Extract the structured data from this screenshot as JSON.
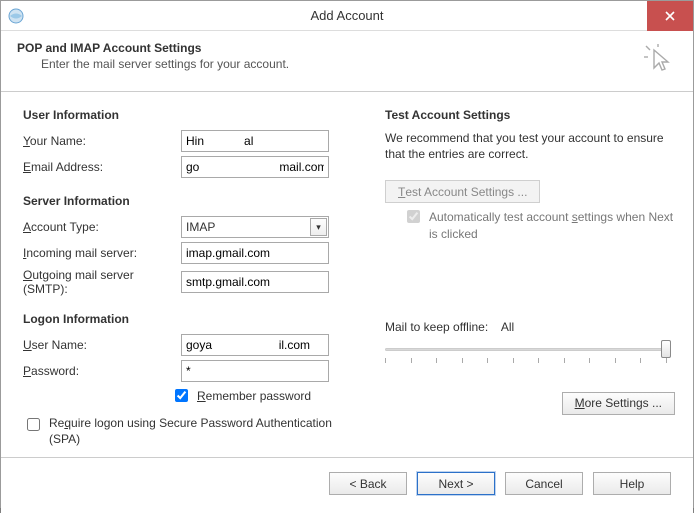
{
  "window": {
    "title": "Add Account"
  },
  "header": {
    "title": "POP and IMAP Account Settings",
    "subtitle": "Enter the mail server settings for your account."
  },
  "sections": {
    "user": "User Information",
    "server": "Server Information",
    "logon": "Logon Information",
    "test": "Test Account Settings"
  },
  "labels": {
    "your_name": "Your Name:",
    "email": "Email Address:",
    "account_type": "Account Type:",
    "incoming": "Incoming mail server:",
    "outgoing": "Outgoing mail server (SMTP):",
    "user_name": "User Name:",
    "password": "Password:",
    "remember": "Remember password",
    "spa": "Require logon using Secure Password Authentication (SPA)",
    "auto_test": "Automatically test account settings when Next is clicked",
    "mail_keep": "Mail to keep offline:",
    "mail_keep_value": "All"
  },
  "values": {
    "your_name": "Hin            al",
    "email": "go                        mail.com",
    "account_type": "IMAP",
    "incoming": "imap.gmail.com",
    "outgoing": "smtp.gmail.com",
    "user_name": "goya                    il.com",
    "password": "*",
    "remember_checked": true,
    "spa_checked": false,
    "auto_test_checked": true
  },
  "right": {
    "intro": "We recommend that you test your account to ensure that the entries are correct.",
    "test_btn": "Test Account Settings ...",
    "more_btn": "More Settings ..."
  },
  "footer": {
    "back": "< Back",
    "next": "Next >",
    "cancel": "Cancel",
    "help": "Help"
  }
}
